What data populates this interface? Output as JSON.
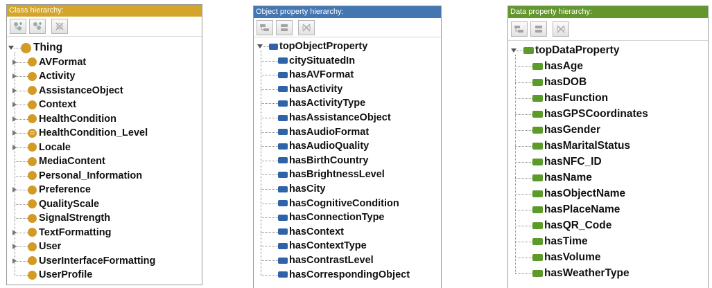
{
  "colors": {
    "class_header": "#d4a52b",
    "object_header": "#4476b1",
    "data_header": "#63962d",
    "class_icon": "#d29a26",
    "object_icon": "#2f63a8",
    "data_icon": "#5c9a2a"
  },
  "class_panel": {
    "title": "Class hierarchy:",
    "toolbar": [
      "add-subclass-icon",
      "add-sibling-class-icon",
      "delete-class-icon"
    ],
    "root": "Thing",
    "items": [
      {
        "label": "AVFormat",
        "expandable": true,
        "icon": "class-icon"
      },
      {
        "label": "Activity",
        "expandable": true,
        "icon": "class-icon"
      },
      {
        "label": "AssistanceObject",
        "expandable": true,
        "icon": "class-icon"
      },
      {
        "label": "Context",
        "expandable": true,
        "icon": "class-icon"
      },
      {
        "label": "HealthCondition",
        "expandable": true,
        "icon": "class-icon"
      },
      {
        "label": "HealthCondition_Level",
        "expandable": true,
        "icon": "defined-class-icon"
      },
      {
        "label": "Locale",
        "expandable": true,
        "icon": "class-icon"
      },
      {
        "label": "MediaContent",
        "expandable": false,
        "icon": "class-icon"
      },
      {
        "label": "Personal_Information",
        "expandable": false,
        "icon": "class-icon"
      },
      {
        "label": "Preference",
        "expandable": true,
        "icon": "class-icon"
      },
      {
        "label": "QualityScale",
        "expandable": false,
        "icon": "class-icon"
      },
      {
        "label": "SignalStrength",
        "expandable": false,
        "icon": "class-icon"
      },
      {
        "label": "TextFormatting",
        "expandable": true,
        "icon": "class-icon"
      },
      {
        "label": "User",
        "expandable": true,
        "icon": "class-icon"
      },
      {
        "label": "UserInterfaceFormatting",
        "expandable": true,
        "icon": "class-icon"
      },
      {
        "label": "UserProfile",
        "expandable": false,
        "icon": "class-icon"
      }
    ]
  },
  "object_panel": {
    "title": "Object property hierarchy:",
    "toolbar": [
      "add-sub-property-icon",
      "add-sibling-property-icon",
      "delete-property-icon"
    ],
    "root": "topObjectProperty",
    "items": [
      "citySituatedIn",
      "hasAVFormat",
      "hasActivity",
      "hasActivityType",
      "hasAssistanceObject",
      "hasAudioFormat",
      "hasAudioQuality",
      "hasBirthCountry",
      "hasBrightnessLevel",
      "hasCity",
      "hasCognitiveCondition",
      "hasConnectionType",
      "hasContext",
      "hasContextType",
      "hasContrastLevel",
      "hasCorrespondingObject"
    ]
  },
  "data_panel": {
    "title": "Data property hierarchy:",
    "toolbar": [
      "add-sub-property-icon",
      "add-sibling-property-icon",
      "delete-property-icon"
    ],
    "root": "topDataProperty",
    "items": [
      "hasAge",
      "hasDOB",
      "hasFunction",
      "hasGPSCoordinates",
      "hasGender",
      "hasMaritalStatus",
      "hasNFC_ID",
      "hasName",
      "hasObjectName",
      "hasPlaceName",
      "hasQR_Code",
      "hasTime",
      "hasVolume",
      "hasWeatherType"
    ]
  }
}
